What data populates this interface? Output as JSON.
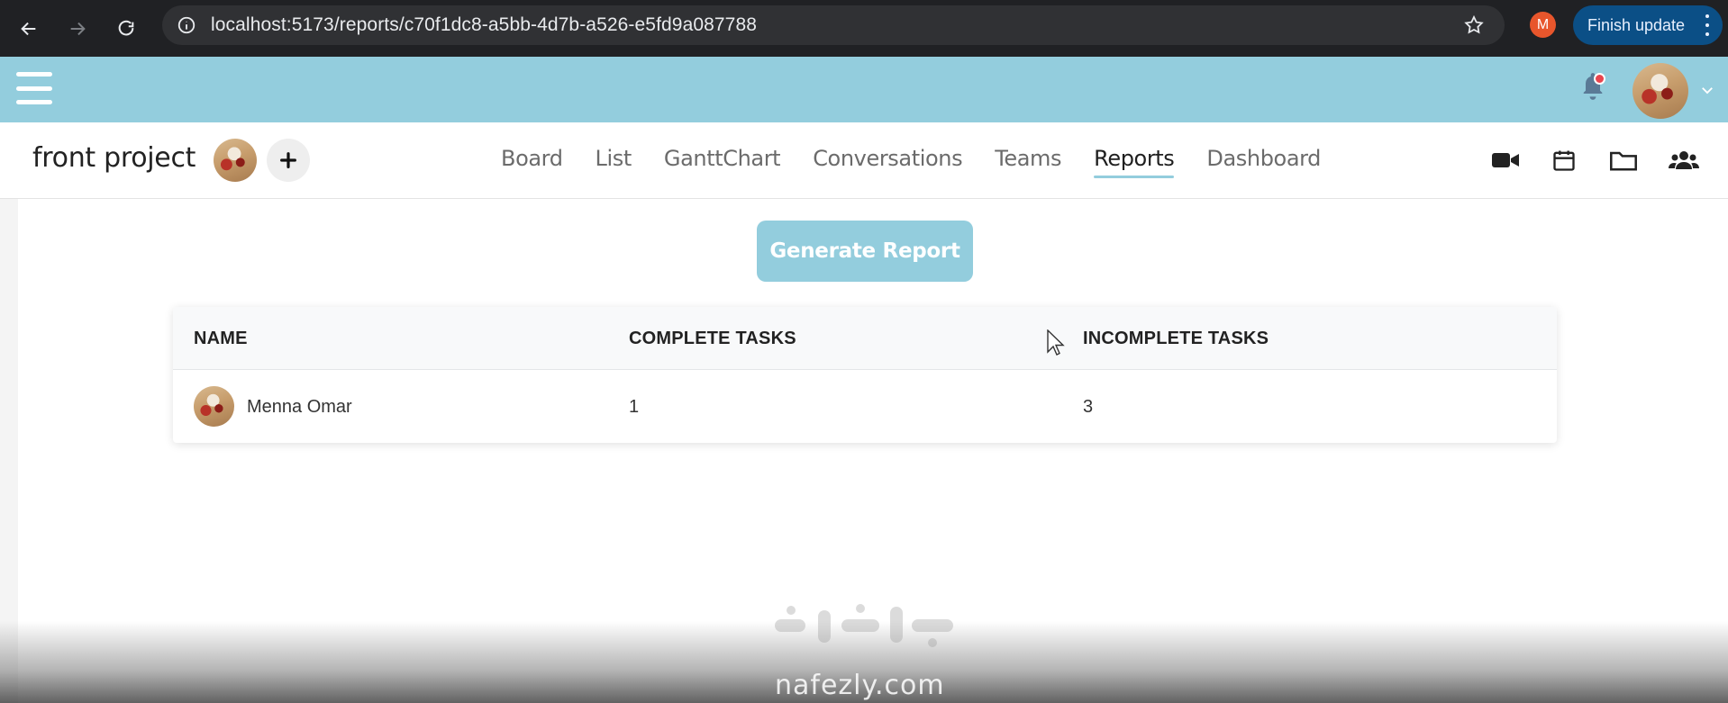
{
  "browser": {
    "url": "localhost:5173/reports/c70f1dc8-a5bb-4d7b-a526-e5fd9a087788",
    "profile_initial": "M",
    "finish_update_label": "Finish update"
  },
  "project": {
    "title": "front project",
    "tabs": [
      {
        "label": "Board"
      },
      {
        "label": "List"
      },
      {
        "label": "GanttChart"
      },
      {
        "label": "Conversations"
      },
      {
        "label": "Teams"
      },
      {
        "label": "Reports",
        "active": true
      },
      {
        "label": "Dashboard"
      }
    ]
  },
  "reports": {
    "generate_label": "Generate Report",
    "columns": [
      "NAME",
      "COMPLETE TASKS",
      "INCOMPLETE TASKS"
    ],
    "rows": [
      {
        "name": "Menna Omar",
        "complete": "1",
        "incomplete": "3"
      }
    ]
  },
  "watermark": {
    "text": "nafezly.com"
  },
  "colors": {
    "accent": "#93cddd",
    "notification": "#e8454f",
    "browser_bg": "#202124"
  }
}
